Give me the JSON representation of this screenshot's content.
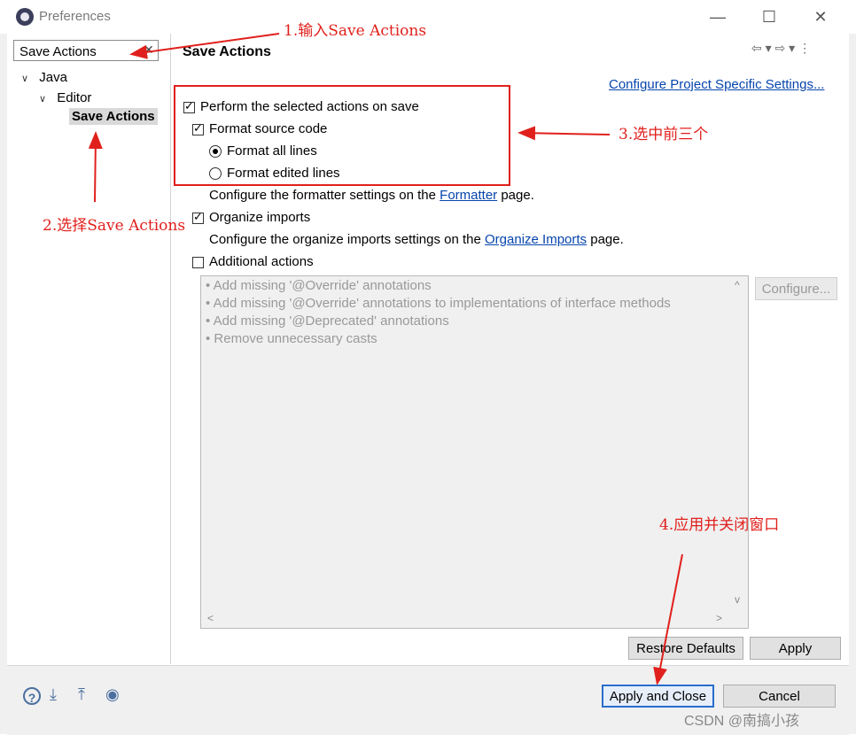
{
  "window": {
    "title": "Preferences",
    "minimize": "—",
    "maximize": "☐",
    "close": "✕"
  },
  "search": {
    "value": "Save Actions",
    "clear": "✕"
  },
  "tree": {
    "java": "Java",
    "editor": "Editor",
    "save_actions": "Save Actions",
    "chevron": "∨"
  },
  "page": {
    "heading": "Save Actions",
    "nav": "⇦ ▾ ⇨ ▾ ⋮",
    "configure_link": "Configure Project Specific Settings..."
  },
  "options": {
    "perform": {
      "label": "Perform the selected actions on save",
      "checked": true
    },
    "format_source": {
      "label": "Format source code",
      "checked": true
    },
    "format_all": {
      "label": "Format all lines",
      "selected": true
    },
    "format_edited": {
      "label": "Format edited lines",
      "selected": false
    },
    "formatter_prefix": "Configure the formatter settings on the",
    "formatter_link": "Formatter",
    "formatter_suffix": "page.",
    "organize": {
      "label": "Organize imports",
      "checked": true
    },
    "organize_prefix": "Configure the organize imports settings on the",
    "organize_link": "Organize Imports",
    "organize_suffix": "page.",
    "additional": {
      "label": "Additional actions",
      "checked": false
    }
  },
  "additional_list": [
    "• Add missing '@Override' annotations",
    "• Add missing '@Override' annotations to implementations of interface methods",
    "• Add missing '@Deprecated' annotations",
    "• Remove unnecessary casts"
  ],
  "scroll": {
    "up": "^",
    "down": "v",
    "left": "<",
    "right": ">"
  },
  "buttons": {
    "configure": "Configure...",
    "restore_defaults": "Restore Defaults",
    "apply": "Apply",
    "apply_and_close": "Apply and Close",
    "cancel": "Cancel"
  },
  "bottom_icons": {
    "help": "?",
    "import": "⤓",
    "export": "⤒",
    "record": "◉"
  },
  "annotations": {
    "step1": "1.输入Save Actions",
    "step2": "2.选择Save Actions",
    "step3": "3.选中前三个",
    "step4": "4.应用并关闭窗口",
    "color": "#e0201c"
  },
  "background_fragments": {
    "e": "e",
    "t": "t"
  },
  "watermark": "CSDN @南搞小孩"
}
